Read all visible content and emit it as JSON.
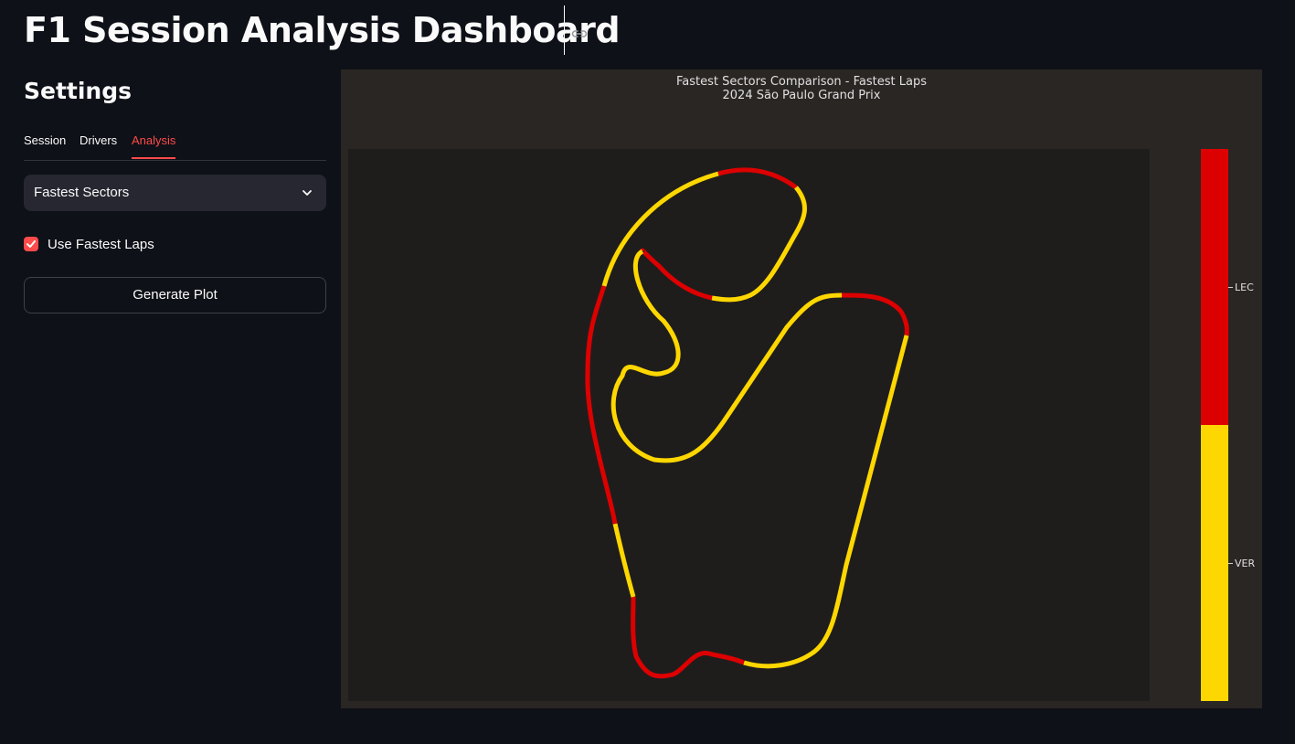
{
  "header": {
    "title": "F1 Session Analysis Dashboard",
    "link_icon": "link-icon"
  },
  "sidebar": {
    "title": "Settings",
    "tabs": [
      {
        "label": "Session",
        "active": false
      },
      {
        "label": "Drivers",
        "active": false
      },
      {
        "label": "Analysis",
        "active": true
      }
    ],
    "analysis_select": {
      "value": "Fastest Sectors",
      "icon": "chevron-down-icon"
    },
    "use_fastest_laps": {
      "label": "Use Fastest Laps",
      "checked": true
    },
    "generate_button": {
      "label": "Generate Plot"
    },
    "accent_color": "#ff4b4b"
  },
  "chart_data": {
    "type": "track-map",
    "title": "Fastest Sectors Comparison - Fastest Laps",
    "subtitle": "2024 São Paulo Grand Prix",
    "legend": [
      {
        "driver": "LEC",
        "color": "#dd0000"
      },
      {
        "driver": "VER",
        "color": "#ffd700"
      }
    ],
    "segments": [
      {
        "driver": "VER"
      },
      {
        "driver": "LEC"
      },
      {
        "driver": "VER"
      },
      {
        "driver": "LEC"
      },
      {
        "driver": "VER"
      },
      {
        "driver": "LEC"
      },
      {
        "driver": "VER"
      },
      {
        "driver": "LEC"
      },
      {
        "driver": "VER"
      },
      {
        "driver": "LEC"
      },
      {
        "driver": "VER"
      },
      {
        "driver": "LEC"
      },
      {
        "driver": "VER"
      }
    ]
  }
}
